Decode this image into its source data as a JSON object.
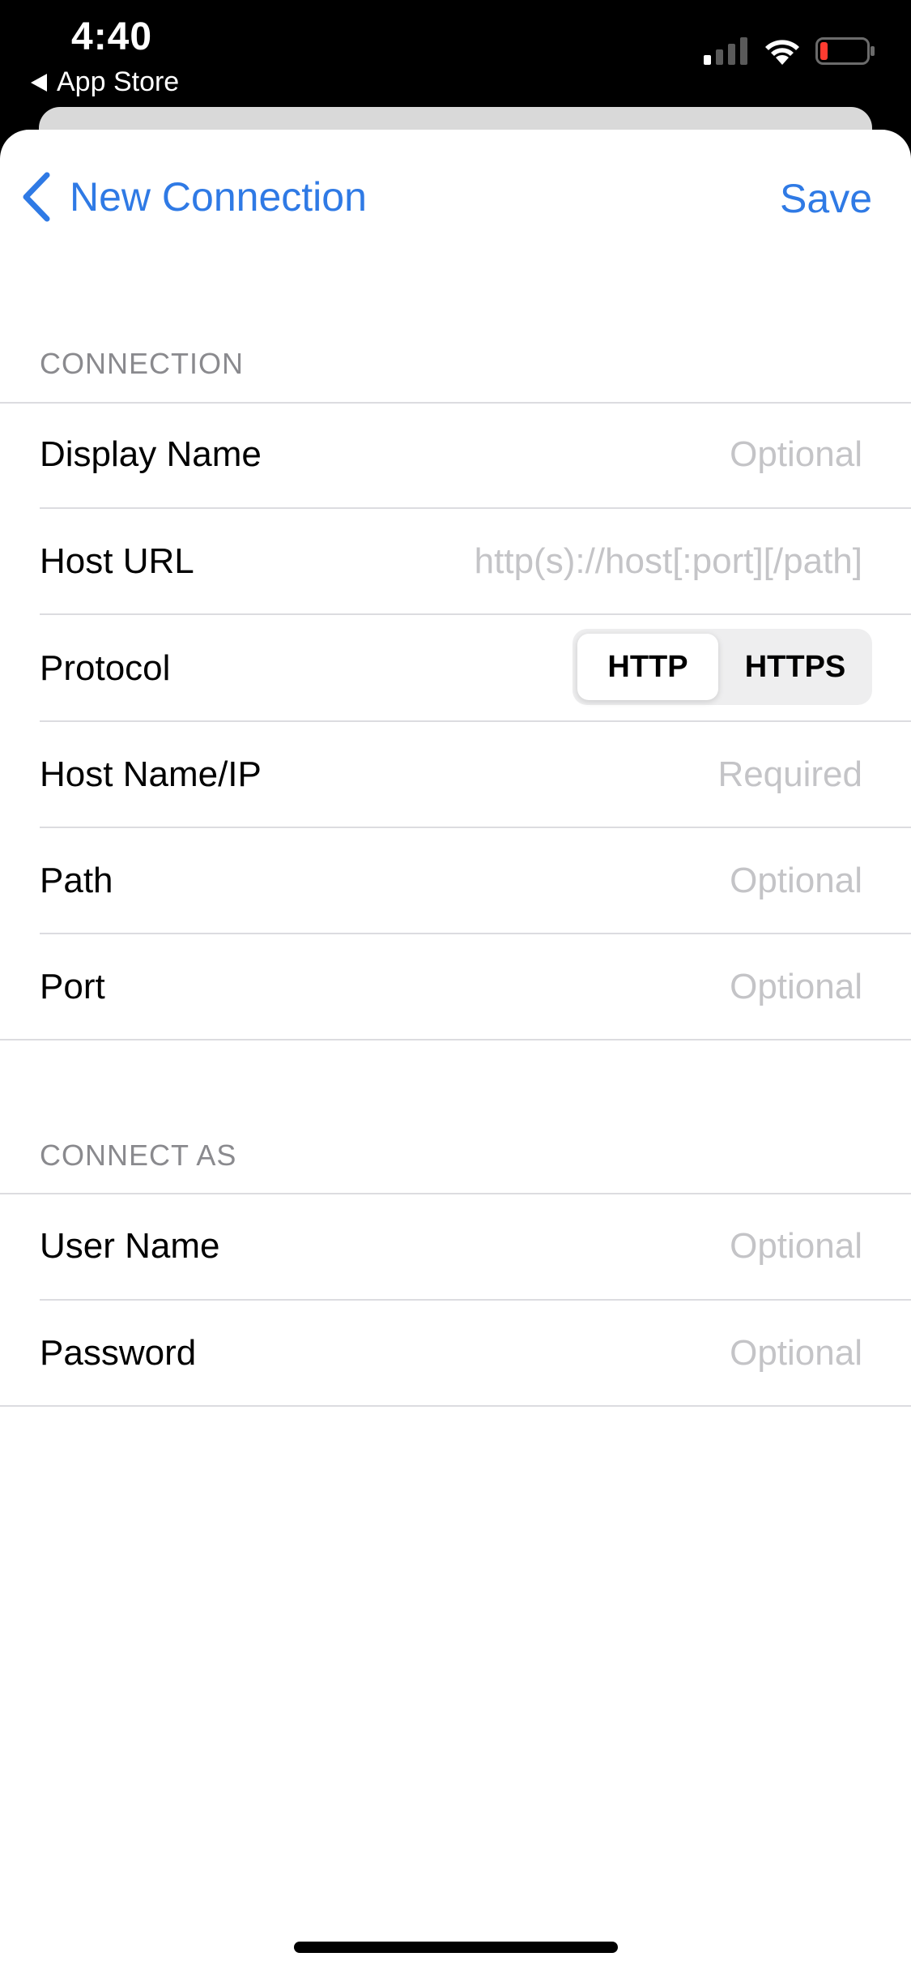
{
  "status_bar": {
    "time": "4:40",
    "back_app": "App Store",
    "icons": [
      "signal-icon",
      "wifi-icon",
      "battery-low-icon"
    ]
  },
  "nav": {
    "back_label": "New Connection",
    "save_label": "Save"
  },
  "sections": {
    "connection": {
      "header": "CONNECTION",
      "display_name": {
        "label": "Display Name",
        "placeholder": "Optional"
      },
      "host_url": {
        "label": "Host URL",
        "placeholder": "http(s)://host[:port][/path]"
      },
      "protocol": {
        "label": "Protocol",
        "options": [
          "HTTP",
          "HTTPS"
        ],
        "selected": "HTTP"
      },
      "host_name": {
        "label": "Host Name/IP",
        "placeholder": "Required"
      },
      "path": {
        "label": "Path",
        "placeholder": "Optional"
      },
      "port": {
        "label": "Port",
        "placeholder": "Optional"
      }
    },
    "connect_as": {
      "header": "CONNECT AS",
      "user_name": {
        "label": "User Name",
        "placeholder": "Optional"
      },
      "password": {
        "label": "Password",
        "placeholder": "Optional"
      }
    }
  },
  "colors": {
    "accent": "#2f7ae5",
    "placeholder": "#c4c4c7",
    "section_header": "#8a8a8e",
    "separator": "#dcdce0"
  }
}
